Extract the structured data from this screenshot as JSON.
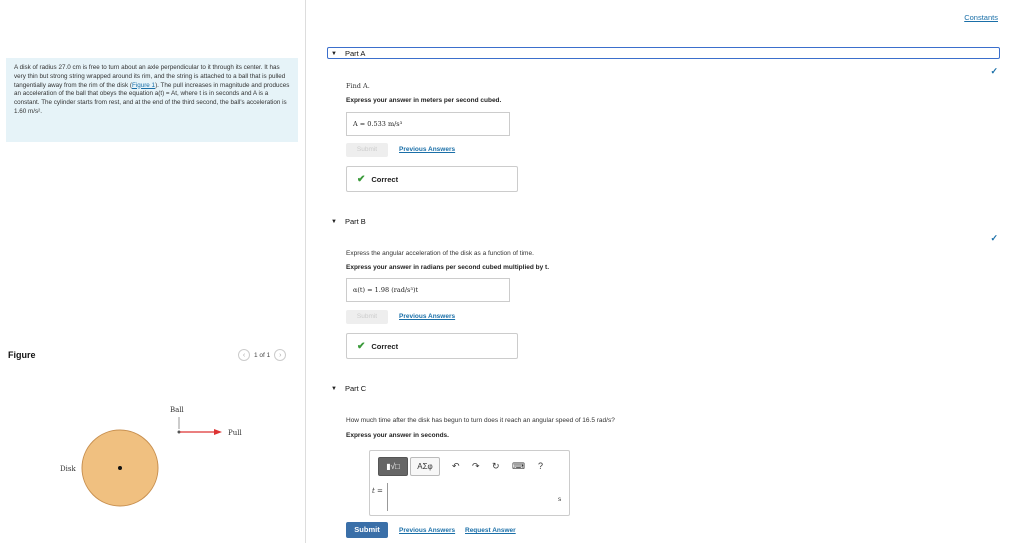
{
  "problem": {
    "text_pre": "A disk of radius 27.0 cm is free to turn about an axle perpendicular to it through its center. It has very thin but strong string wrapped around its rim, and the string is attached to a ball that is pulled tangentially away from the rim of the disk (",
    "figure_link": "Figure 1",
    "text_post": "). The pull increases in magnitude and produces an acceleration of the ball that obeys the equation a(t) = At, where t is in seconds and A is a constant. The cylinder starts from rest, and at the end of the third second, the ball's acceleration is 1.60 m/s²."
  },
  "figure": {
    "label": "Figure",
    "pager": "1 of 1",
    "prev_icon": "chevron-left-icon",
    "next_icon": "chevron-right-icon",
    "ball_label": "Ball",
    "pull_label": "Pull",
    "disk_label": "Disk",
    "disk_color": "#f0c080"
  },
  "constants_link": "Constants",
  "parts": {
    "a": {
      "title": "Part A",
      "prompt": "Find A.",
      "instruction": "Express your answer in meters per second cubed.",
      "answer": "A =  0.533  m/s³",
      "submit": "Submit",
      "previous": "Previous Answers",
      "status": "Correct"
    },
    "b": {
      "title": "Part B",
      "prompt": "Express the angular acceleration of the disk as a function of time.",
      "instruction": "Express your answer in radians per second cubed multiplied by t.",
      "answer": "α(t) =  1.98  (rad/s³)t",
      "submit": "Submit",
      "previous": "Previous Answers",
      "status": "Correct"
    },
    "c": {
      "title": "Part C",
      "prompt": "How much time after the disk has begun to turn does it reach an angular speed of 16.5 rad/s?",
      "instruction": "Express your answer in seconds.",
      "var": "t =",
      "unit": "s",
      "submit": "Submit",
      "previous": "Previous Answers",
      "request": "Request Answer",
      "tool_sym": "ΑΣφ",
      "tool_help": "?"
    }
  },
  "colors": {
    "accent": "#3a6fa8",
    "problem_bg": "#e6f3f8",
    "correct": "#3a9a3a"
  }
}
